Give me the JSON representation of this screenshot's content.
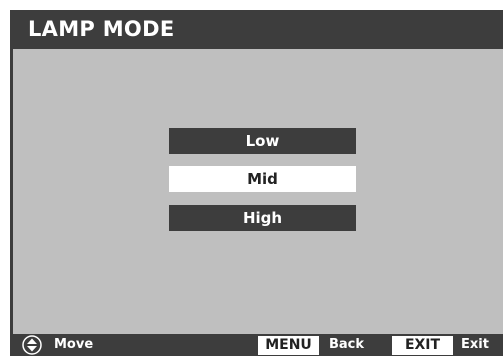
{
  "title": "LAMP MODE",
  "options": [
    {
      "label": "Low",
      "selected": false
    },
    {
      "label": "Mid",
      "selected": true
    },
    {
      "label": "High",
      "selected": false
    }
  ],
  "footer": {
    "move_icon": "updown-arrows-icon",
    "move_label": "Move",
    "menu_key": "MENU",
    "back_label": "Back",
    "exit_key": "EXIT",
    "exit_label": "Exit"
  },
  "colors": {
    "panel": "#3d3d3d",
    "content_bg": "#bfbfbf",
    "highlight": "#ffffff"
  }
}
